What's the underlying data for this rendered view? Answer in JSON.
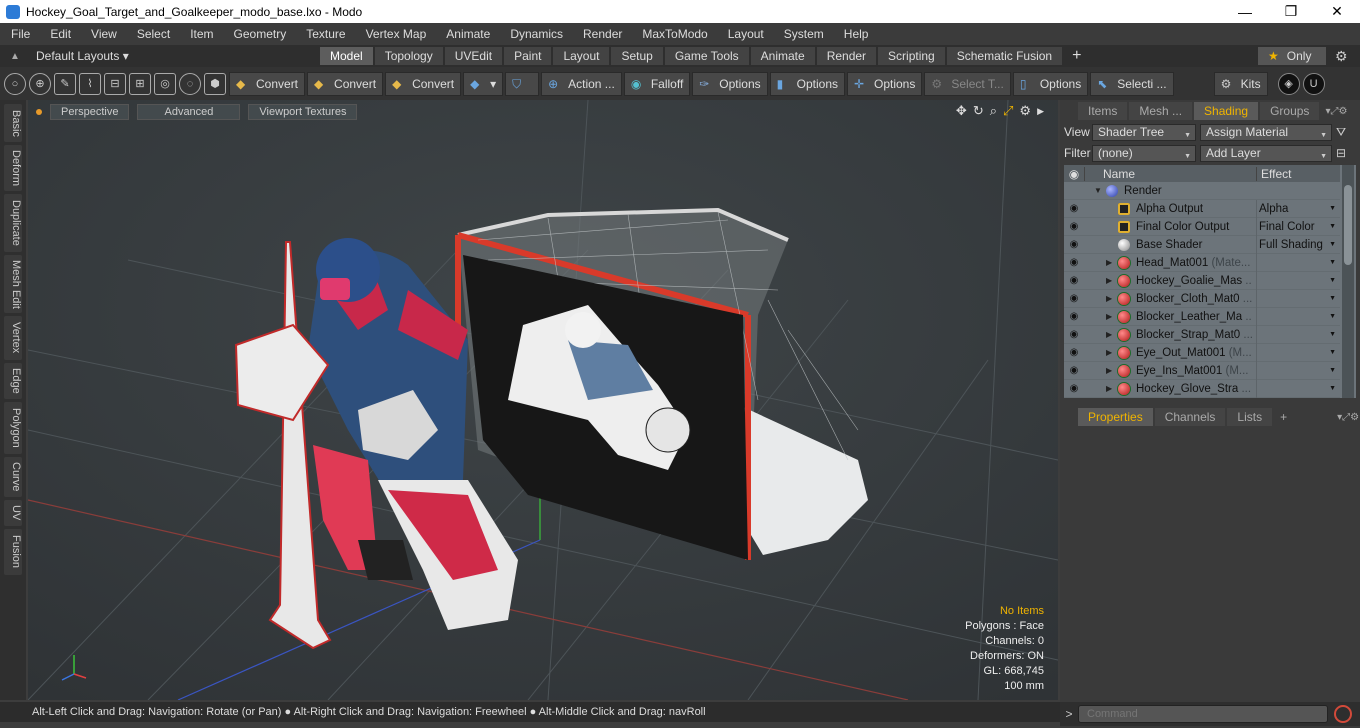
{
  "window": {
    "title": "Hockey_Goal_Target_and_Goalkeeper_modo_base.lxo - Modo"
  },
  "menubar": {
    "items": [
      "File",
      "Edit",
      "View",
      "Select",
      "Item",
      "Geometry",
      "Texture",
      "Vertex Map",
      "Animate",
      "Dynamics",
      "Render",
      "MaxToModo",
      "Layout",
      "System",
      "Help"
    ]
  },
  "layouts": {
    "label": "Default Layouts ▾"
  },
  "tabs": [
    "Model",
    "Topology",
    "UVEdit",
    "Paint",
    "Layout",
    "Setup",
    "Game Tools",
    "Animate",
    "Render",
    "Scripting",
    "Schematic Fusion"
  ],
  "active_tab": "Model",
  "only_label": "Only",
  "toolbar": {
    "convert1": "Convert",
    "convert2": "Convert",
    "convert3": "Convert",
    "action": "Action ...",
    "falloff": "Falloff",
    "options1": "Options",
    "options2": "Options",
    "options3": "Options",
    "select_t": "Select T...",
    "options4": "Options",
    "selecti": "Selecti ...",
    "kits": "Kits"
  },
  "left_strip": [
    "Basic",
    "Deform",
    "Duplicate",
    "Mesh Edit",
    "Vertex",
    "Edge",
    "Polygon",
    "Curve",
    "UV",
    "Fusion"
  ],
  "viewport": {
    "buttons": [
      "Perspective",
      "Advanced",
      "Viewport Textures"
    ],
    "hud": {
      "no_items": "No Items",
      "polygons": "Polygons : Face",
      "channels": "Channels: 0",
      "deformers": "Deformers: ON",
      "gl": "GL: 668,745",
      "scale": "100 mm"
    }
  },
  "status": {
    "text": "Alt-Left Click and Drag: Navigation: Rotate (or Pan) ● Alt-Right Click and Drag: Navigation: Freewheel ● Alt-Middle Click and Drag: navRoll"
  },
  "right_panel": {
    "tabs": [
      "Items",
      "Mesh ...",
      "Shading",
      "Groups"
    ],
    "active_tab": "Shading",
    "view_label": "View",
    "view_value": "Shader Tree",
    "assign_material": "Assign Material",
    "filter_label": "Filter",
    "filter_value": "(none)",
    "add_layer": "Add Layer",
    "col_name": "Name",
    "col_effect": "Effect",
    "rows": [
      {
        "name": "Render",
        "grey": "",
        "effect": "",
        "icon": "sphere-blue",
        "level": 0,
        "eye": false
      },
      {
        "name": "Alpha Output",
        "grey": "",
        "effect": "Alpha",
        "icon": "output",
        "level": 1,
        "eye": true
      },
      {
        "name": "Final Color Output",
        "grey": "",
        "effect": "Final Color",
        "icon": "output",
        "level": 1,
        "eye": true
      },
      {
        "name": "Base Shader",
        "grey": "",
        "effect": "Full Shading",
        "icon": "sphere-white",
        "level": 1,
        "eye": true
      },
      {
        "name": "Head_Mat001",
        "grey": " (Mate...",
        "effect": "",
        "icon": "mat",
        "level": 1,
        "eye": true
      },
      {
        "name": "Hockey_Goalie_Mas",
        "grey": " ...",
        "effect": "",
        "icon": "mat",
        "level": 1,
        "eye": true
      },
      {
        "name": "Blocker_Cloth_Mat0",
        "grey": " ...",
        "effect": "",
        "icon": "mat",
        "level": 1,
        "eye": true
      },
      {
        "name": "Blocker_Leather_Ma",
        "grey": " ...",
        "effect": "",
        "icon": "mat",
        "level": 1,
        "eye": true
      },
      {
        "name": "Blocker_Strap_Mat0",
        "grey": " ...",
        "effect": "",
        "icon": "mat",
        "level": 1,
        "eye": true
      },
      {
        "name": "Eye_Out_Mat001",
        "grey": " (M...",
        "effect": "",
        "icon": "mat",
        "level": 1,
        "eye": true
      },
      {
        "name": "Eye_Ins_Mat001",
        "grey": " (M...",
        "effect": "",
        "icon": "mat",
        "level": 1,
        "eye": true
      },
      {
        "name": "Hockey_Glove_Stra",
        "grey": " ...",
        "effect": "",
        "icon": "mat",
        "level": 1,
        "eye": true
      }
    ],
    "props_tabs": [
      "Properties",
      "Channels",
      "Lists"
    ],
    "props_active": "Properties"
  },
  "command": {
    "placeholder": "Command"
  }
}
